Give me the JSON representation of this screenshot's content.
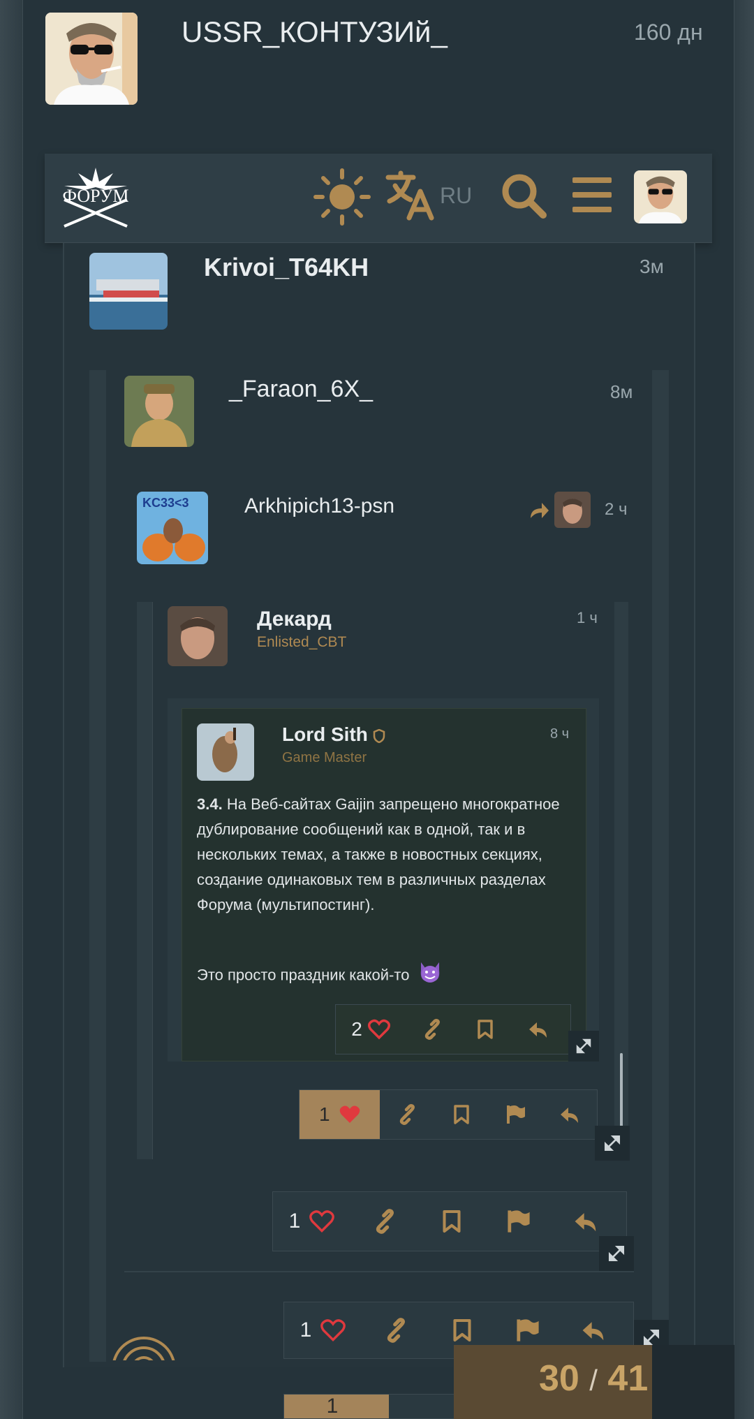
{
  "posts": {
    "top": {
      "username": "USSR_КОНТУЗИй_",
      "time": "160 дн"
    },
    "krivoi": {
      "username": "Krivoi_T64KH",
      "time": "3м"
    },
    "faraon": {
      "username": "_Faraon_6X_",
      "time": "8м"
    },
    "arkhipich": {
      "username": "Arkhipich13-psn",
      "time": "2 ч"
    },
    "dekard": {
      "username": "Декард",
      "title": "Enlisted_CBT",
      "time": "1 ч"
    },
    "lordsith": {
      "username": "Lord Sith",
      "title": "Game Master",
      "time": "8 ч",
      "rule_number": "3.4.",
      "rule_text": "На Веб-сайтах Gaijin запрещено многократное дублирование сообщений как в одной, так и в нескольких темах, а также в новостных секциях, создание одинаковых тем в различных разделах Форума (мультипостинг).",
      "comment": "Это просто праздник какой-то"
    }
  },
  "header": {
    "logo_text": "ФОРУМ",
    "language": "RU"
  },
  "actions": {
    "lordsith_likes": "2",
    "dekard_likes": "1",
    "arkhipich_likes": "1",
    "faraon_likes": "1",
    "next_likes": "1"
  },
  "progress": {
    "current": "30",
    "separator": "/",
    "total": "41"
  },
  "colors": {
    "accent": "#b08a52",
    "heart": "#e0393e",
    "liked_bg": "#a4845a"
  }
}
